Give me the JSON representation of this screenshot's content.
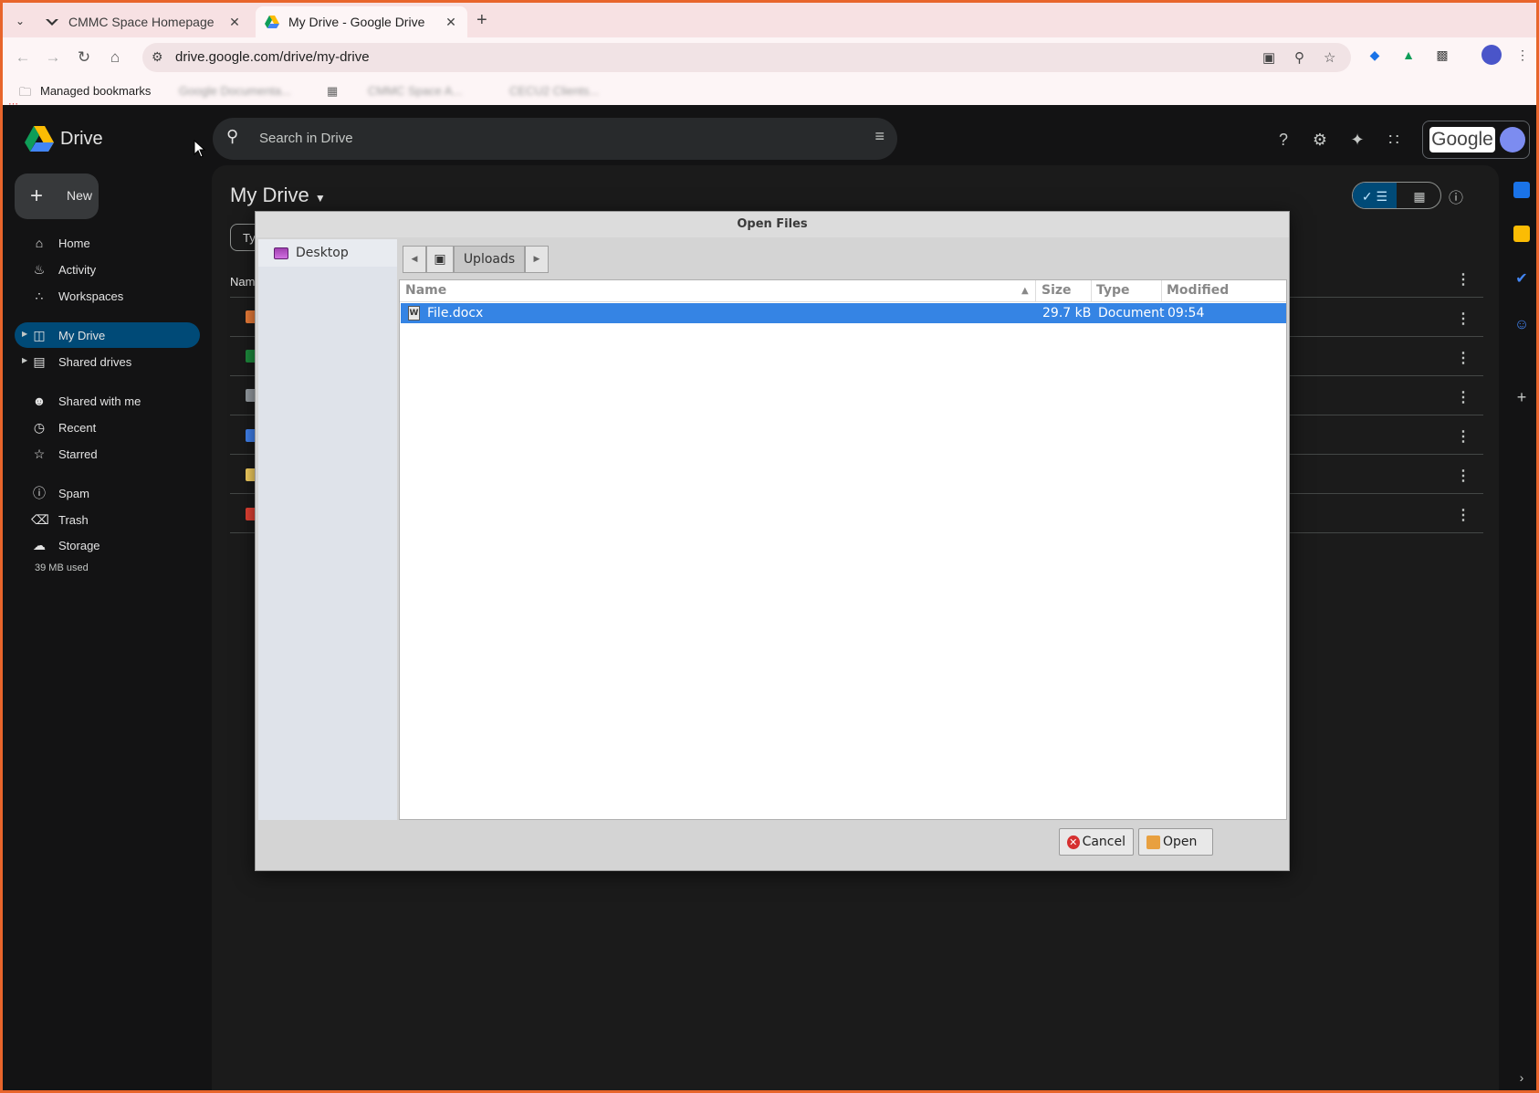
{
  "browser": {
    "tabs": [
      {
        "title": "CMMC Space Homepage",
        "active": false
      },
      {
        "title": "My Drive - Google Drive",
        "active": true
      }
    ],
    "url": "drive.google.com/drive/my-drive",
    "bookmarks": {
      "managed": "Managed bookmarks",
      "item1": "Google Documenta...",
      "item2": "CMMC Space A...",
      "item3": "CECU2 Clients..."
    }
  },
  "drive": {
    "app_name": "Drive",
    "search_placeholder": "Search in Drive",
    "account_label": "Google",
    "new_label": "New",
    "nav": {
      "home": "Home",
      "activity": "Activity",
      "workspaces": "Workspaces",
      "my_drive": "My Drive",
      "shared_drives": "Shared drives",
      "shared_with_me": "Shared with me",
      "recent": "Recent",
      "starred": "Starred",
      "spam": "Spam",
      "trash": "Trash",
      "storage": "Storage"
    },
    "storage_used": "39 MB used",
    "page_title": "My Drive",
    "filter_chip": "Ty",
    "column_name": "Nam",
    "folder_colors": [
      "#f2803a",
      "#1e8e3e",
      "#9aa0a6",
      "#4285f4",
      "#fdd663",
      "#ea4335"
    ]
  },
  "dialog": {
    "title": "Open Files",
    "places": [
      {
        "label": "Desktop"
      }
    ],
    "path": {
      "current": "Uploads"
    },
    "columns": {
      "name": "Name",
      "size": "Size",
      "type": "Type",
      "modified": "Modified"
    },
    "files": [
      {
        "name": "File.docx",
        "size": "29.7 kB",
        "type": "Document",
        "modified": "09:54",
        "selected": true
      }
    ],
    "cancel_label": "Cancel",
    "open_label": "Open"
  },
  "colors": {
    "accent_selected": "#3584e4",
    "drive_selected_nav": "#004a77",
    "window_border": "#e8652b"
  }
}
